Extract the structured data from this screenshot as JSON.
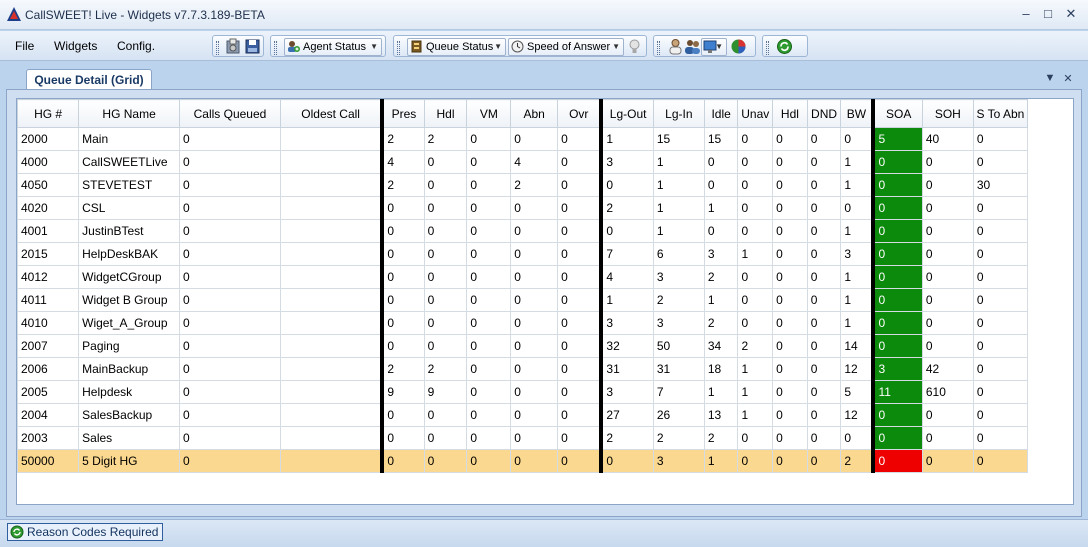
{
  "window": {
    "title": "CallSWEET! Live - Widgets v7.7.3.189-BETA",
    "controls": {
      "minimize": "–",
      "maximize": "□",
      "close": "✕"
    }
  },
  "menu": [
    "File",
    "Widgets",
    "Config."
  ],
  "toolbar": {
    "agent_status": "Agent Status",
    "queue_status": "Queue Status",
    "speed_of_answer": "Speed of Answer"
  },
  "tab": {
    "label": "Queue Detail (Grid)",
    "ctrl_down": "▼",
    "ctrl_close": "✕"
  },
  "grid": {
    "columns": [
      "HG #",
      "HG Name",
      "Calls Queued",
      "Oldest Call",
      "Pres",
      "Hdl",
      "VM",
      "Abn",
      "Ovr",
      "Lg-Out",
      "Lg-In",
      "Idle",
      "Unav",
      "Hdl",
      "DND",
      "BW",
      "SOA",
      "SOH",
      "S To Abn"
    ],
    "rows": [
      {
        "cells": [
          "2000",
          "Main",
          "0",
          "",
          "2",
          "2",
          "0",
          "0",
          "0",
          "1",
          "15",
          "15",
          "0",
          "0",
          "0",
          "0",
          "5",
          "40",
          "0"
        ],
        "soa_status": "green"
      },
      {
        "cells": [
          "4000",
          "CallSWEETLive",
          "0",
          "",
          "4",
          "0",
          "0",
          "4",
          "0",
          "3",
          "1",
          "0",
          "0",
          "0",
          "0",
          "1",
          "0",
          "0",
          "0"
        ],
        "soa_status": "green"
      },
      {
        "cells": [
          "4050",
          "STEVETEST",
          "0",
          "",
          "2",
          "0",
          "0",
          "2",
          "0",
          "0",
          "1",
          "0",
          "0",
          "0",
          "0",
          "1",
          "0",
          "0",
          "30"
        ],
        "soa_status": "green"
      },
      {
        "cells": [
          "4020",
          "CSL",
          "0",
          "",
          "0",
          "0",
          "0",
          "0",
          "0",
          "2",
          "1",
          "1",
          "0",
          "0",
          "0",
          "0",
          "0",
          "0",
          "0"
        ],
        "soa_status": "green"
      },
      {
        "cells": [
          "4001",
          "JustinBTest",
          "0",
          "",
          "0",
          "0",
          "0",
          "0",
          "0",
          "0",
          "1",
          "0",
          "0",
          "0",
          "0",
          "1",
          "0",
          "0",
          "0"
        ],
        "soa_status": "green"
      },
      {
        "cells": [
          "2015",
          "HelpDeskBAK",
          "0",
          "",
          "0",
          "0",
          "0",
          "0",
          "0",
          "7",
          "6",
          "3",
          "1",
          "0",
          "0",
          "3",
          "0",
          "0",
          "0"
        ],
        "soa_status": "green"
      },
      {
        "cells": [
          "4012",
          "WidgetCGroup",
          "0",
          "",
          "0",
          "0",
          "0",
          "0",
          "0",
          "4",
          "3",
          "2",
          "0",
          "0",
          "0",
          "1",
          "0",
          "0",
          "0"
        ],
        "soa_status": "green"
      },
      {
        "cells": [
          "4011",
          "Widget B Group",
          "0",
          "",
          "0",
          "0",
          "0",
          "0",
          "0",
          "1",
          "2",
          "1",
          "0",
          "0",
          "0",
          "1",
          "0",
          "0",
          "0"
        ],
        "soa_status": "green"
      },
      {
        "cells": [
          "4010",
          "Wiget_A_Group",
          "0",
          "",
          "0",
          "0",
          "0",
          "0",
          "0",
          "3",
          "3",
          "2",
          "0",
          "0",
          "0",
          "1",
          "0",
          "0",
          "0"
        ],
        "soa_status": "green"
      },
      {
        "cells": [
          "2007",
          "Paging",
          "0",
          "",
          "0",
          "0",
          "0",
          "0",
          "0",
          "32",
          "50",
          "34",
          "2",
          "0",
          "0",
          "14",
          "0",
          "0",
          "0"
        ],
        "soa_status": "green"
      },
      {
        "cells": [
          "2006",
          "MainBackup",
          "0",
          "",
          "2",
          "2",
          "0",
          "0",
          "0",
          "31",
          "31",
          "18",
          "1",
          "0",
          "0",
          "12",
          "3",
          "42",
          "0"
        ],
        "soa_status": "green"
      },
      {
        "cells": [
          "2005",
          "Helpdesk",
          "0",
          "",
          "9",
          "9",
          "0",
          "0",
          "0",
          "3",
          "7",
          "1",
          "1",
          "0",
          "0",
          "5",
          "11",
          "610",
          "0"
        ],
        "soa_status": "green"
      },
      {
        "cells": [
          "2004",
          "SalesBackup",
          "0",
          "",
          "0",
          "0",
          "0",
          "0",
          "0",
          "27",
          "26",
          "13",
          "1",
          "0",
          "0",
          "12",
          "0",
          "0",
          "0"
        ],
        "soa_status": "green"
      },
      {
        "cells": [
          "2003",
          "Sales",
          "0",
          "",
          "0",
          "0",
          "0",
          "0",
          "0",
          "2",
          "2",
          "2",
          "0",
          "0",
          "0",
          "0",
          "0",
          "0",
          "0"
        ],
        "soa_status": "green"
      },
      {
        "cells": [
          "50000",
          "5 Digit HG",
          "0",
          "",
          "0",
          "0",
          "0",
          "0",
          "0",
          "0",
          "3",
          "1",
          "0",
          "0",
          "0",
          "2",
          "0",
          "0",
          "0"
        ],
        "soa_status": "red",
        "selected": true
      }
    ]
  },
  "status": {
    "reason_codes": "Reason Codes Required"
  },
  "colors": {
    "soa_green": "#0b8a0b",
    "soa_red": "#ee0000",
    "selected_row": "#fbd88f"
  }
}
